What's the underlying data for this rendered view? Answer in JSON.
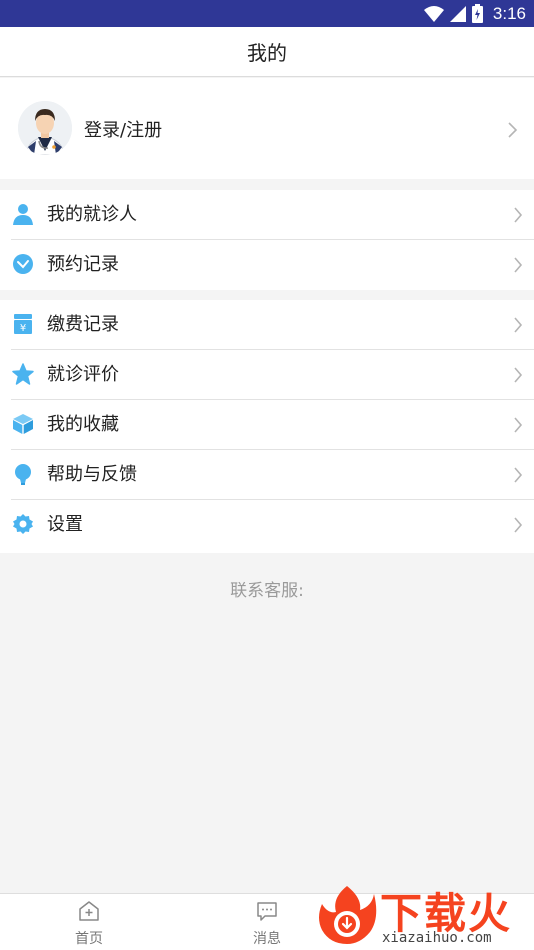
{
  "status_bar": {
    "time": "3:16",
    "background": "#2f3796"
  },
  "header": {
    "title": "我的"
  },
  "profile": {
    "label": "登录/注册",
    "avatar_icon": "doctor-avatar-icon"
  },
  "groups": [
    {
      "items": [
        {
          "label": "我的就诊人",
          "icon": "person-icon"
        },
        {
          "label": "预约记录",
          "icon": "clock-icon"
        }
      ]
    },
    {
      "items": [
        {
          "label": "缴费记录",
          "icon": "payment-icon"
        },
        {
          "label": "就诊评价",
          "icon": "star-icon"
        },
        {
          "label": "我的收藏",
          "icon": "box-icon"
        },
        {
          "label": "帮助与反馈",
          "icon": "bulb-icon"
        },
        {
          "label": "设置",
          "icon": "gear-icon"
        }
      ]
    }
  ],
  "footer": {
    "customer_service": "联系客服:"
  },
  "tab_bar": {
    "tabs": [
      {
        "label": "首页",
        "icon": "home-icon"
      },
      {
        "label": "消息",
        "icon": "message-icon"
      }
    ]
  },
  "watermark": {
    "text": "下载火",
    "url": "xiazaihuo.com"
  },
  "colors": {
    "accent_icon": "#4ab3ef",
    "watermark": "#f5431f"
  }
}
